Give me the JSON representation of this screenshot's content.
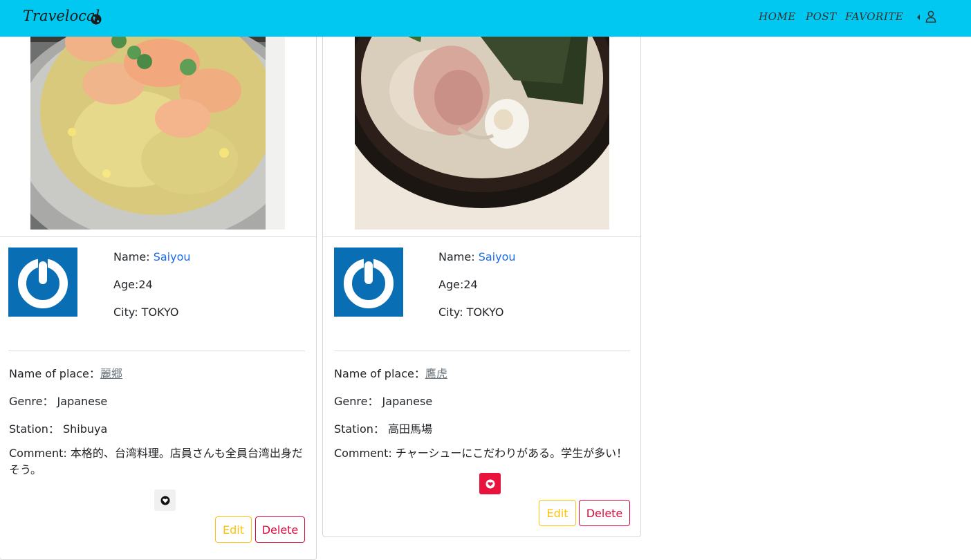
{
  "navbar": {
    "brand": "Travelocal",
    "links": [
      "HOME",
      "POST",
      "FAVORITE"
    ],
    "background": "#00c8f0"
  },
  "posts": [
    {
      "photo": "shrimp fried rice",
      "user_label": "Name:",
      "user_name": "Saiyou",
      "age": "Age:24",
      "city": "City: TOKYO",
      "place_label": "Name of place：",
      "place_name": "麗郷",
      "genre": "Genre： Japanese",
      "station": "Station： Shibuya",
      "comment": "Comment: 本格的、台湾料理。店員さんも全員台湾出身だそう。",
      "favorited": false,
      "edit_label": "Edit",
      "delete_label": "Delete"
    },
    {
      "photo": "ramen bowl",
      "user_label": "Name:",
      "user_name": "Saiyou",
      "age": "Age:24",
      "city": "City: TOKYO",
      "place_label": "Name of place：",
      "place_name": "鷹虎",
      "genre": "Genre： Japanese",
      "station": "Station： 高田馬場",
      "comment": "Comment: チャーシューにこだわりがある。学生が多い！",
      "favorited": true,
      "edit_label": "Edit",
      "delete_label": "Delete"
    }
  ],
  "colors": {
    "accent": "#00c8f0",
    "link": "#1a6ae8",
    "edit": "#ffc107",
    "delete": "#dc0a3c",
    "favorite_active": "#e8123c"
  }
}
